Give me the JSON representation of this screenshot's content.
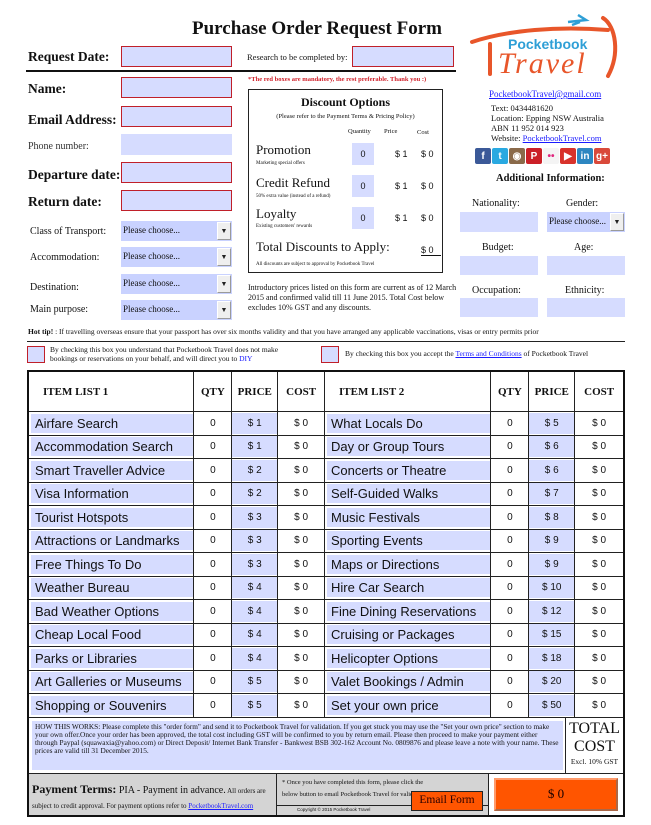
{
  "title": "Purchase Order Request Form",
  "header": {
    "request_date_label": "Request Date:",
    "research_label": "Research to be completed by:",
    "mandatory_note": "*The red boxes are mandatory, the rest preferable. Thank you :)"
  },
  "personal": {
    "name_label": "Name:",
    "email_label": "Email Address:",
    "phone_label": "Phone number:",
    "departure_label": "Departure date:",
    "return_label": "Return date:",
    "class_label": "Class of Transport:",
    "accommodation_label": "Accommodation:",
    "destination_label": "Destination:",
    "purpose_label": "Main purpose:",
    "select_placeholder": "Please choose..."
  },
  "brand": {
    "logo_top": "Pocketbook",
    "logo_bottom": "Travel",
    "email": "PocketbookTravel@gmail.com",
    "text": "Text: 0434481620",
    "location": "Location: Epping NSW Australia",
    "abn": "ABN 11 952 014 923",
    "website_label": "Website: ",
    "website": "PocketbookTravel.com",
    "socials": [
      {
        "name": "facebook",
        "glyph": "f",
        "color": "#3b5998"
      },
      {
        "name": "twitter",
        "glyph": "t",
        "color": "#29a9e1"
      },
      {
        "name": "instagram",
        "glyph": "◉",
        "color": "#8a6a4a"
      },
      {
        "name": "pinterest",
        "glyph": "P",
        "color": "#cb2027"
      },
      {
        "name": "flickr",
        "glyph": "••",
        "color": "#f4f4f4"
      },
      {
        "name": "youtube",
        "glyph": "▶",
        "color": "#d8322b"
      },
      {
        "name": "linkedin",
        "glyph": "in",
        "color": "#2d86c1"
      },
      {
        "name": "googleplus",
        "glyph": "g+",
        "color": "#d9493a"
      }
    ]
  },
  "additional": {
    "title": "Additional Information:",
    "nationality": "Nationality:",
    "gender": "Gender:",
    "gender_value": "Please choose...",
    "budget": "Budget:",
    "age": "Age:",
    "occupation": "Occupation:",
    "ethnicity": "Ethnicity:"
  },
  "discounts": {
    "title": "Discount Options",
    "subtitle": "(Please refer to the Payment Terms & Pricing Policy)",
    "col_quantity": "Quantity",
    "col_price": "Price",
    "col_cost": "Cost",
    "items": [
      {
        "name": "Promotion",
        "sub": "Marketing special offers",
        "qty": "0",
        "price": "$ 1",
        "cost": "$ 0"
      },
      {
        "name": "Credit Refund",
        "sub": "50% extra value (instead of a refund)",
        "qty": "0",
        "price": "$ 1",
        "cost": "$ 0"
      },
      {
        "name": "Loyalty",
        "sub": "Existing customers' rewards",
        "qty": "0",
        "price": "$ 1",
        "cost": "$ 0"
      }
    ],
    "total_label": "Total Discounts to Apply:",
    "total_value": "$ 0",
    "footnote": "All discounts are subject to approval by Pocketbook Travel"
  },
  "intro_note": "Introductory prices listed on this form are current as of 12 March 2015 and confirmed valid till 11 June 2015. Total Cost below excludes 10% GST and any discounts.",
  "hot_tip": {
    "label": "Hot tip!",
    "text": " : If travelling overseas ensure that your passport has over six months validity and that you have arranged any applicable vaccinations, visas or entry permits prior"
  },
  "checkboxes": {
    "diy_text": "By checking this box you understand that Pocketbook Travel does not make bookings or reservations on your behalf, and will direct you to ",
    "diy_link": "DIY",
    "terms_text": "By checking this box you accept the ",
    "terms_link": "Terms and Conditions",
    "terms_suffix": " of Pocketbook Travel"
  },
  "table": {
    "headers": {
      "list1": "ITEM LIST 1",
      "list2": "ITEM LIST 2",
      "qty": "QTY",
      "price": "PRICE",
      "cost": "COST"
    },
    "rows": [
      {
        "i1": "Airfare Search",
        "q1": "0",
        "p1": "$ 1",
        "c1": "$ 0",
        "i2": "What Locals Do",
        "q2": "0",
        "p2": "$ 5",
        "c2": "$ 0"
      },
      {
        "i1": "Accommodation Search",
        "q1": "0",
        "p1": "$ 1",
        "c1": "$ 0",
        "i2": "Day or Group Tours",
        "q2": "0",
        "p2": "$ 6",
        "c2": "$ 0"
      },
      {
        "i1": "Smart Traveller Advice",
        "q1": "0",
        "p1": "$ 2",
        "c1": "$ 0",
        "i2": "Concerts or Theatre",
        "q2": "0",
        "p2": "$ 6",
        "c2": "$ 0"
      },
      {
        "i1": "Visa Information",
        "q1": "0",
        "p1": "$ 2",
        "c1": "$ 0",
        "i2": "Self-Guided Walks",
        "q2": "0",
        "p2": "$ 7",
        "c2": "$ 0"
      },
      {
        "i1": "Tourist Hotspots",
        "q1": "0",
        "p1": "$ 3",
        "c1": "$ 0",
        "i2": "Music Festivals",
        "q2": "0",
        "p2": "$ 8",
        "c2": "$ 0"
      },
      {
        "i1": "Attractions or Landmarks",
        "q1": "0",
        "p1": "$ 3",
        "c1": "$ 0",
        "i2": "Sporting Events",
        "q2": "0",
        "p2": "$ 9",
        "c2": "$ 0"
      },
      {
        "i1": "Free Things To Do",
        "q1": "0",
        "p1": "$ 3",
        "c1": "$ 0",
        "i2": "Maps or Directions",
        "q2": "0",
        "p2": "$ 9",
        "c2": "$ 0"
      },
      {
        "i1": "Weather Bureau",
        "q1": "0",
        "p1": "$ 4",
        "c1": "$ 0",
        "i2": "Hire Car Search",
        "q2": "0",
        "p2": "$ 10",
        "c2": "$ 0"
      },
      {
        "i1": "Bad Weather Options",
        "q1": "0",
        "p1": "$ 4",
        "c1": "$ 0",
        "i2": "Fine Dining Reservations",
        "q2": "0",
        "p2": "$ 12",
        "c2": "$ 0"
      },
      {
        "i1": "Cheap Local Food",
        "q1": "0",
        "p1": "$ 4",
        "c1": "$ 0",
        "i2": "Cruising or Packages",
        "q2": "0",
        "p2": "$ 15",
        "c2": "$ 0"
      },
      {
        "i1": "Parks or Libraries",
        "q1": "0",
        "p1": "$ 4",
        "c1": "$ 0",
        "i2": "Helicopter Options",
        "q2": "0",
        "p2": "$ 18",
        "c2": "$ 0"
      },
      {
        "i1": "Art Galleries or Museums",
        "q1": "0",
        "p1": "$ 5",
        "c1": "$ 0",
        "i2": "Valet Bookings / Admin",
        "q2": "0",
        "p2": "$ 20",
        "c2": "$ 0"
      },
      {
        "i1": "Shopping or Souvenirs",
        "q1": "0",
        "p1": "$ 5",
        "c1": "$ 0",
        "i2": "Set your own price",
        "q2": "0",
        "p2": "$ 50",
        "c2": "$ 0"
      }
    ]
  },
  "how_it_works": "HOW THIS WORKS: Please complete this \"order form\" and send it to Pocketbook Travel for validation. If you get stuck you may use the \"Set your own price\" section to make your own offer.Once your order has been approved, the total cost including GST will be confirmed to you by return email. Please then proceed to make your payment either through Paypal (squawaxia@yahoo.com) or Direct Deposit/ Internet Bank Transfer - Bankwest BSB 302-162 Account No. 0809876 and please leave a note with your name. These prices are valid till 31 December 2015.",
  "total": {
    "label1": "TOTAL",
    "label2": "COST",
    "sub": "Excl. 10% GST",
    "value": "$ 0"
  },
  "footer": {
    "payment_title": "Payment Terms:",
    "payment_main": " PIA - Payment in advance.",
    "payment_small": "  All orders are subject to credit approval. For payment options refer to ",
    "payment_link": "PocketbookTravel.com",
    "email_note": "* Once you have completed this form, please click the below button to email Pocketbook Travel for validation.",
    "email_button": "Email Form",
    "copyright": "Copyright © 2015 Pocketbook Travel"
  },
  "colors": {
    "field": "#d6dcff",
    "mandatory_border": "#c0202a",
    "button": "#ff5500",
    "brand_orange": "#e8562a",
    "brand_blue": "#2e9fd6"
  }
}
